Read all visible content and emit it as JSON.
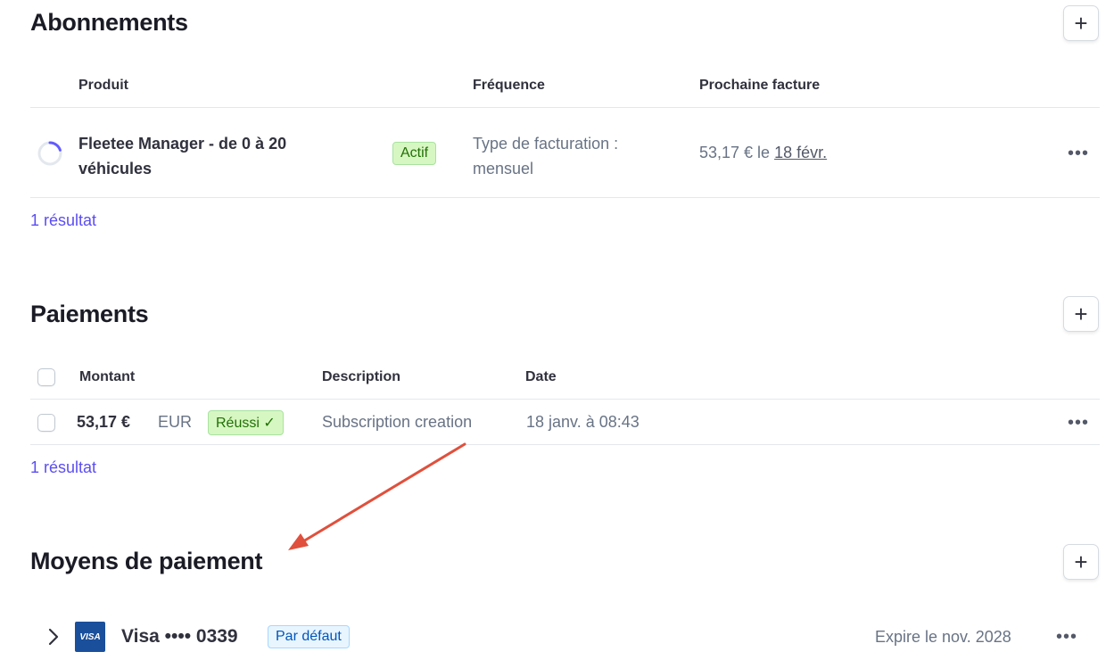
{
  "subscriptions": {
    "title": "Abonnements",
    "columns": [
      "Produit",
      "Fréquence",
      "Prochaine facture"
    ],
    "row": {
      "product_line1": "Fleetee Manager - de 0 à 20",
      "product_line2": "véhicules",
      "status": "Actif",
      "frequency_line1": "Type de facturation :",
      "frequency_line2": "mensuel",
      "next_invoice_amount": "53,17 € le",
      "next_invoice_date": "18 févr.",
      "more": "•••"
    },
    "result_count": "1 résultat"
  },
  "payments": {
    "title": "Paiements",
    "columns": [
      "Montant",
      "Description",
      "Date"
    ],
    "row": {
      "amount": "53,17 €",
      "currency": "EUR",
      "status": "Réussi",
      "description": "Subscription creation",
      "date": "18 janv. à 08:43",
      "more": "•••"
    },
    "result_count": "1 résultat"
  },
  "payment_methods": {
    "title": "Moyens de paiement",
    "card": {
      "brand_logo": "VISA",
      "label": "Visa •••• 0339",
      "default_badge": "Par défaut",
      "expiry": "Expire le nov. 2028",
      "more": "•••"
    }
  },
  "icons": {
    "add": "+",
    "check": "✓",
    "chevron": "chevron-right-icon",
    "spinner": "progress-circle-icon"
  },
  "colors": {
    "link": "#5b4df3",
    "success_bg": "#d7f7c2",
    "success_text": "#217005",
    "default_bg": "#e8f5ff",
    "arrow": "#e0503c"
  }
}
